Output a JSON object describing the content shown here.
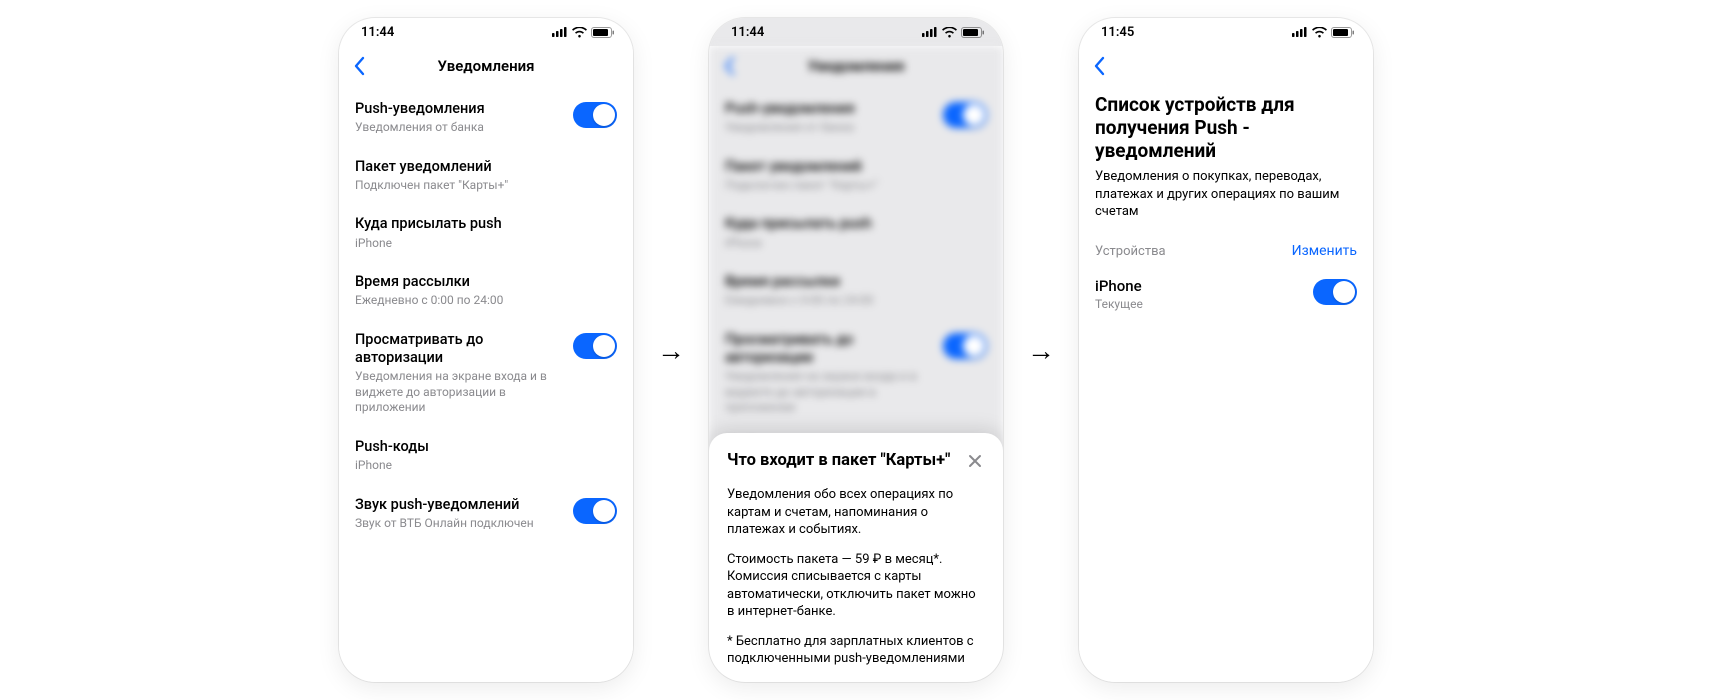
{
  "accent": "#0a66ff",
  "screen1": {
    "time": "11:44",
    "title": "Уведомления",
    "items": [
      {
        "title": "Push-уведомления",
        "sub": "Уведомления от банка",
        "toggle": true
      },
      {
        "title": "Пакет уведомлений",
        "sub": "Подключен пакет \"Карты+\"",
        "toggle": false
      },
      {
        "title": "Куда присылать push",
        "sub": "iPhone",
        "toggle": false
      },
      {
        "title": "Время рассылки",
        "sub": "Ежедневно с 0:00 по 24:00",
        "toggle": false
      },
      {
        "title": "Просматривать до авторизации",
        "sub": "Уведомления на экране входа и в виджете до авторизации в приложении",
        "toggle": true
      },
      {
        "title": "Push-коды",
        "sub": "iPhone",
        "toggle": false
      },
      {
        "title": "Звук push-уведомлений",
        "sub": "Звук от ВТБ Онлайн подключен",
        "toggle": true
      }
    ]
  },
  "screen2": {
    "time": "11:44",
    "title": "Уведомления",
    "sheet": {
      "title": "Что входит в пакет \"Карты+\"",
      "p1": "Уведомления обо всех операциях по картам и счетам, напоминания о платежах и событиях.",
      "p2": "Стоимость пакета — 59 ₽ в месяц*. Комиссия списывается с карты автоматически, отключить пакет можно в интернет-банке.",
      "p3": "* Бесплатно для зарплатных клиентов с подключенными push-уведомлениями"
    }
  },
  "screen3": {
    "time": "11:45",
    "big_title": "Список устройств для получения Push - уведомлений",
    "big_sub": "Уведомления о покупках, переводах, платежах и других операциях по вашим счетам",
    "devices_label": "Устройства",
    "edit_label": "Изменить",
    "device": {
      "name": "iPhone",
      "sub": "Текущее"
    }
  }
}
